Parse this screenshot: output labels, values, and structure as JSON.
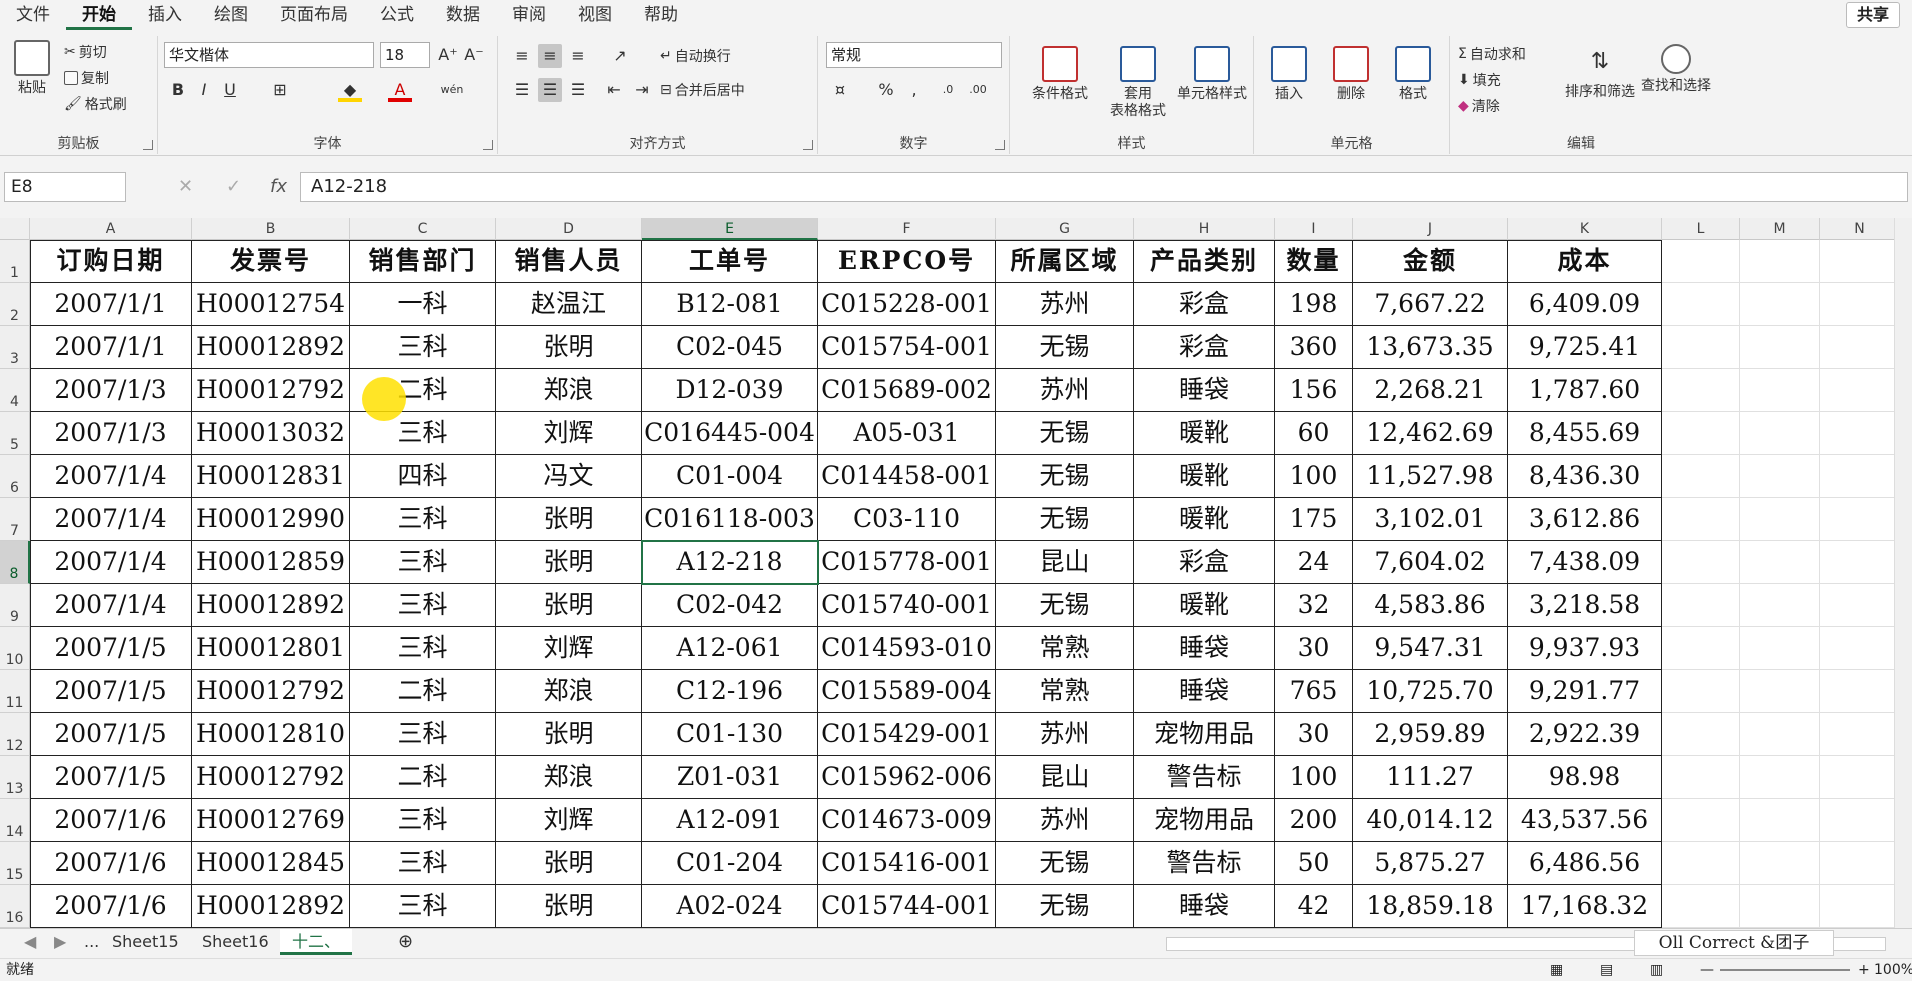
{
  "menu": {
    "items": [
      "文件",
      "开始",
      "插入",
      "绘图",
      "页面布局",
      "公式",
      "数据",
      "审阅",
      "视图",
      "帮助"
    ],
    "active_index": 1,
    "share_label": "共享"
  },
  "ribbon": {
    "clipboard": {
      "label": "剪贴板",
      "paste": "粘贴",
      "cut": "剪切",
      "copy": "复制",
      "format_painter": "格式刷"
    },
    "font": {
      "label": "字体",
      "name": "华文楷体",
      "size": "18",
      "bold": "B",
      "italic": "I",
      "underline": "U"
    },
    "alignment": {
      "label": "对齐方式",
      "wrap": "自动换行",
      "merge": "合并后居中"
    },
    "number": {
      "label": "数字",
      "format": "常规"
    },
    "styles": {
      "label": "样式",
      "conditional": "条件格式",
      "table_l1": "套用",
      "table_l2": "表格格式",
      "cell_styles": "单元格样式"
    },
    "cells": {
      "label": "单元格",
      "insert": "插入",
      "delete": "删除",
      "format": "格式"
    },
    "editing": {
      "label": "编辑",
      "autosum": "自动求和",
      "fill": "填充",
      "clear": "清除",
      "sort": "排序和筛选",
      "find": "查找和选择"
    }
  },
  "formula_bar": {
    "name_box": "E8",
    "fx": "fx",
    "value": "A12-218"
  },
  "sheet": {
    "columns": [
      "A",
      "B",
      "C",
      "D",
      "E",
      "F",
      "G",
      "H",
      "I",
      "J",
      "K",
      "L",
      "M",
      "N"
    ],
    "selected_column": 4,
    "selected_row": 8,
    "header": [
      "订购日期",
      "发票号",
      "销售部门",
      "销售人员",
      "工单号",
      "ERPCO号",
      "所属区域",
      "产品类别",
      "数量",
      "金额",
      "成本"
    ],
    "rows": [
      [
        "2007/1/1",
        "H00012754",
        "一科",
        "赵温江",
        "B12-081",
        "C015228-001",
        "苏州",
        "彩盒",
        "198",
        "7,667.22",
        "6,409.09"
      ],
      [
        "2007/1/1",
        "H00012892",
        "三科",
        "张明",
        "C02-045",
        "C015754-001",
        "无锡",
        "彩盒",
        "360",
        "13,673.35",
        "9,725.41"
      ],
      [
        "2007/1/3",
        "H00012792",
        "二科",
        "郑浪",
        "D12-039",
        "C015689-002",
        "苏州",
        "睡袋",
        "156",
        "2,268.21",
        "1,787.60"
      ],
      [
        "2007/1/3",
        "H00013032",
        "三科",
        "刘辉",
        "C016445-004",
        "A05-031",
        "无锡",
        "暖靴",
        "60",
        "12,462.69",
        "8,455.69"
      ],
      [
        "2007/1/4",
        "H00012831",
        "四科",
        "冯文",
        "C01-004",
        "C014458-001",
        "无锡",
        "暖靴",
        "100",
        "11,527.98",
        "8,436.30"
      ],
      [
        "2007/1/4",
        "H00012990",
        "三科",
        "张明",
        "C016118-003",
        "C03-110",
        "无锡",
        "暖靴",
        "175",
        "3,102.01",
        "3,612.86"
      ],
      [
        "2007/1/4",
        "H00012859",
        "三科",
        "张明",
        "A12-218",
        "C015778-001",
        "昆山",
        "彩盒",
        "24",
        "7,604.02",
        "7,438.09"
      ],
      [
        "2007/1/4",
        "H00012892",
        "三科",
        "张明",
        "C02-042",
        "C015740-001",
        "无锡",
        "暖靴",
        "32",
        "4,583.86",
        "3,218.58"
      ],
      [
        "2007/1/5",
        "H00012801",
        "三科",
        "刘辉",
        "A12-061",
        "C014593-010",
        "常熟",
        "睡袋",
        "30",
        "9,547.31",
        "9,937.93"
      ],
      [
        "2007/1/5",
        "H00012792",
        "二科",
        "郑浪",
        "C12-196",
        "C015589-004",
        "常熟",
        "睡袋",
        "765",
        "10,725.70",
        "9,291.77"
      ],
      [
        "2007/1/5",
        "H00012810",
        "三科",
        "张明",
        "C01-130",
        "C015429-001",
        "苏州",
        "宠物用品",
        "30",
        "2,959.89",
        "2,922.39"
      ],
      [
        "2007/1/5",
        "H00012792",
        "二科",
        "郑浪",
        "Z01-031",
        "C015962-006",
        "昆山",
        "警告标",
        "100",
        "111.27",
        "98.98"
      ],
      [
        "2007/1/6",
        "H00012769",
        "三科",
        "刘辉",
        "A12-091",
        "C014673-009",
        "苏州",
        "宠物用品",
        "200",
        "40,014.12",
        "43,537.56"
      ],
      [
        "2007/1/6",
        "H00012845",
        "三科",
        "张明",
        "C01-204",
        "C015416-001",
        "无锡",
        "警告标",
        "50",
        "5,875.27",
        "6,486.56"
      ],
      [
        "2007/1/6",
        "H00012892",
        "三科",
        "张明",
        "A02-024",
        "C015744-001",
        "无锡",
        "睡袋",
        "42",
        "18,859.18",
        "17,168.32"
      ]
    ]
  },
  "tabs": {
    "items": [
      "...",
      "Sheet15",
      "Sheet16",
      "十二、"
    ],
    "active_index": 3
  },
  "status": {
    "ready": "就绪",
    "zoom": "100%"
  },
  "overlay_label": "Oll Correct &团子"
}
